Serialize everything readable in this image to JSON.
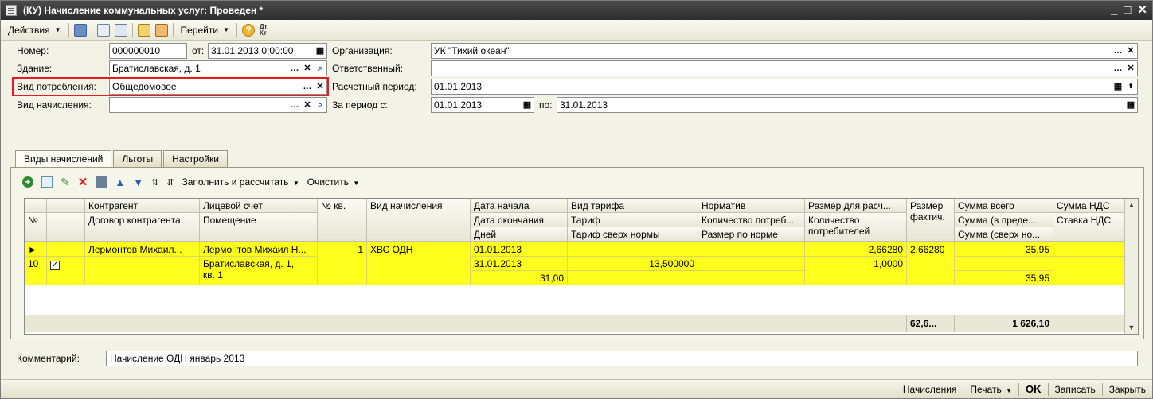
{
  "window": {
    "title": "(КУ) Начисление коммунальных услуг: Проведен *",
    "controls": {
      "minimize": "_",
      "maximize": "□",
      "close": "✕"
    }
  },
  "toolbar": {
    "actions_label": "Действия",
    "goto_label": "Перейти",
    "dtkt_label": "Дт Кт"
  },
  "form": {
    "number": {
      "label": "Номер:",
      "value": "000000010"
    },
    "date": {
      "label": "от:",
      "value": "31.01.2013  0:00:00"
    },
    "organization": {
      "label": "Организация:",
      "value": "УК \"Тихий океан\""
    },
    "building": {
      "label": "Здание:",
      "value": "Братиславская, д. 1"
    },
    "responsible": {
      "label": "Ответственный:",
      "value": ""
    },
    "consumption_type": {
      "label": "Вид потребления:",
      "value": "Общедомовое"
    },
    "calc_period": {
      "label": "Расчетный период:",
      "value": "01.01.2013"
    },
    "accrual_type": {
      "label": "Вид начисления:",
      "value": ""
    },
    "period_from": {
      "label": "За период с:",
      "value": "01.01.2013"
    },
    "period_to": {
      "label": "по:",
      "value": "31.01.2013"
    }
  },
  "tabs": [
    {
      "label": "Виды начислений"
    },
    {
      "label": "Льготы"
    },
    {
      "label": "Настройки"
    }
  ],
  "grid_toolbar": {
    "fill_label": "Заполнить и рассчитать",
    "clear_label": "Очистить"
  },
  "grid": {
    "headers": {
      "num": "№",
      "contractor": "Контрагент",
      "contract": "Договор контрагента",
      "account": "Лицевой счет",
      "premises": "Помещение",
      "apt_num": "№ кв.",
      "accrual_type": "Вид начисления",
      "date_start": "Дата начала",
      "date_end": "Дата окончания",
      "days": "Дней",
      "tariff_type": "Вид тарифа",
      "tariff": "Тариф",
      "tariff_over": "Тариф сверх нормы",
      "norm": "Норматив",
      "consumption_qty": "Количество потреб...",
      "size_norm": "Размер по норме",
      "calc_size": "Размер для расч...",
      "consumers_qty": "Количество потребителей",
      "actual_size": "Размер фактич.",
      "sum_total": "Сумма всего",
      "sum_within": "Сумма (в преде...",
      "sum_over": "Сумма (сверх но...",
      "vat_sum": "Сумма НДС",
      "vat_rate": "Ставка НДС"
    },
    "row": {
      "num": "10",
      "checked": true,
      "contractor": "Лермонтов Михаил...",
      "account": "Лермонтов Михаил Н...",
      "premises_line1": "Братиславская, д. 1,",
      "premises_line2": "кв. 1",
      "apt_num": "1",
      "accrual_type": "ХВС ОДН",
      "date_start": "01.01.2013",
      "date_end": "31.01.2013",
      "days": "31,00",
      "tariff": "13,500000",
      "calc_size": "2,66280",
      "consumers_qty": "1,0000",
      "actual_size": "2,66280",
      "sum_total": "35,95",
      "sum_over": "35,95"
    },
    "totals": {
      "actual_size": "62,6...",
      "sum_total": "1 626,10"
    }
  },
  "comment": {
    "label": "Комментарий:",
    "value": "Начисление ОДН январь 2013"
  },
  "footer": {
    "accruals_label": "Начисления",
    "print_label": "Печать",
    "ok_label": "OK",
    "save_label": "Записать",
    "close_label": "Закрыть"
  }
}
